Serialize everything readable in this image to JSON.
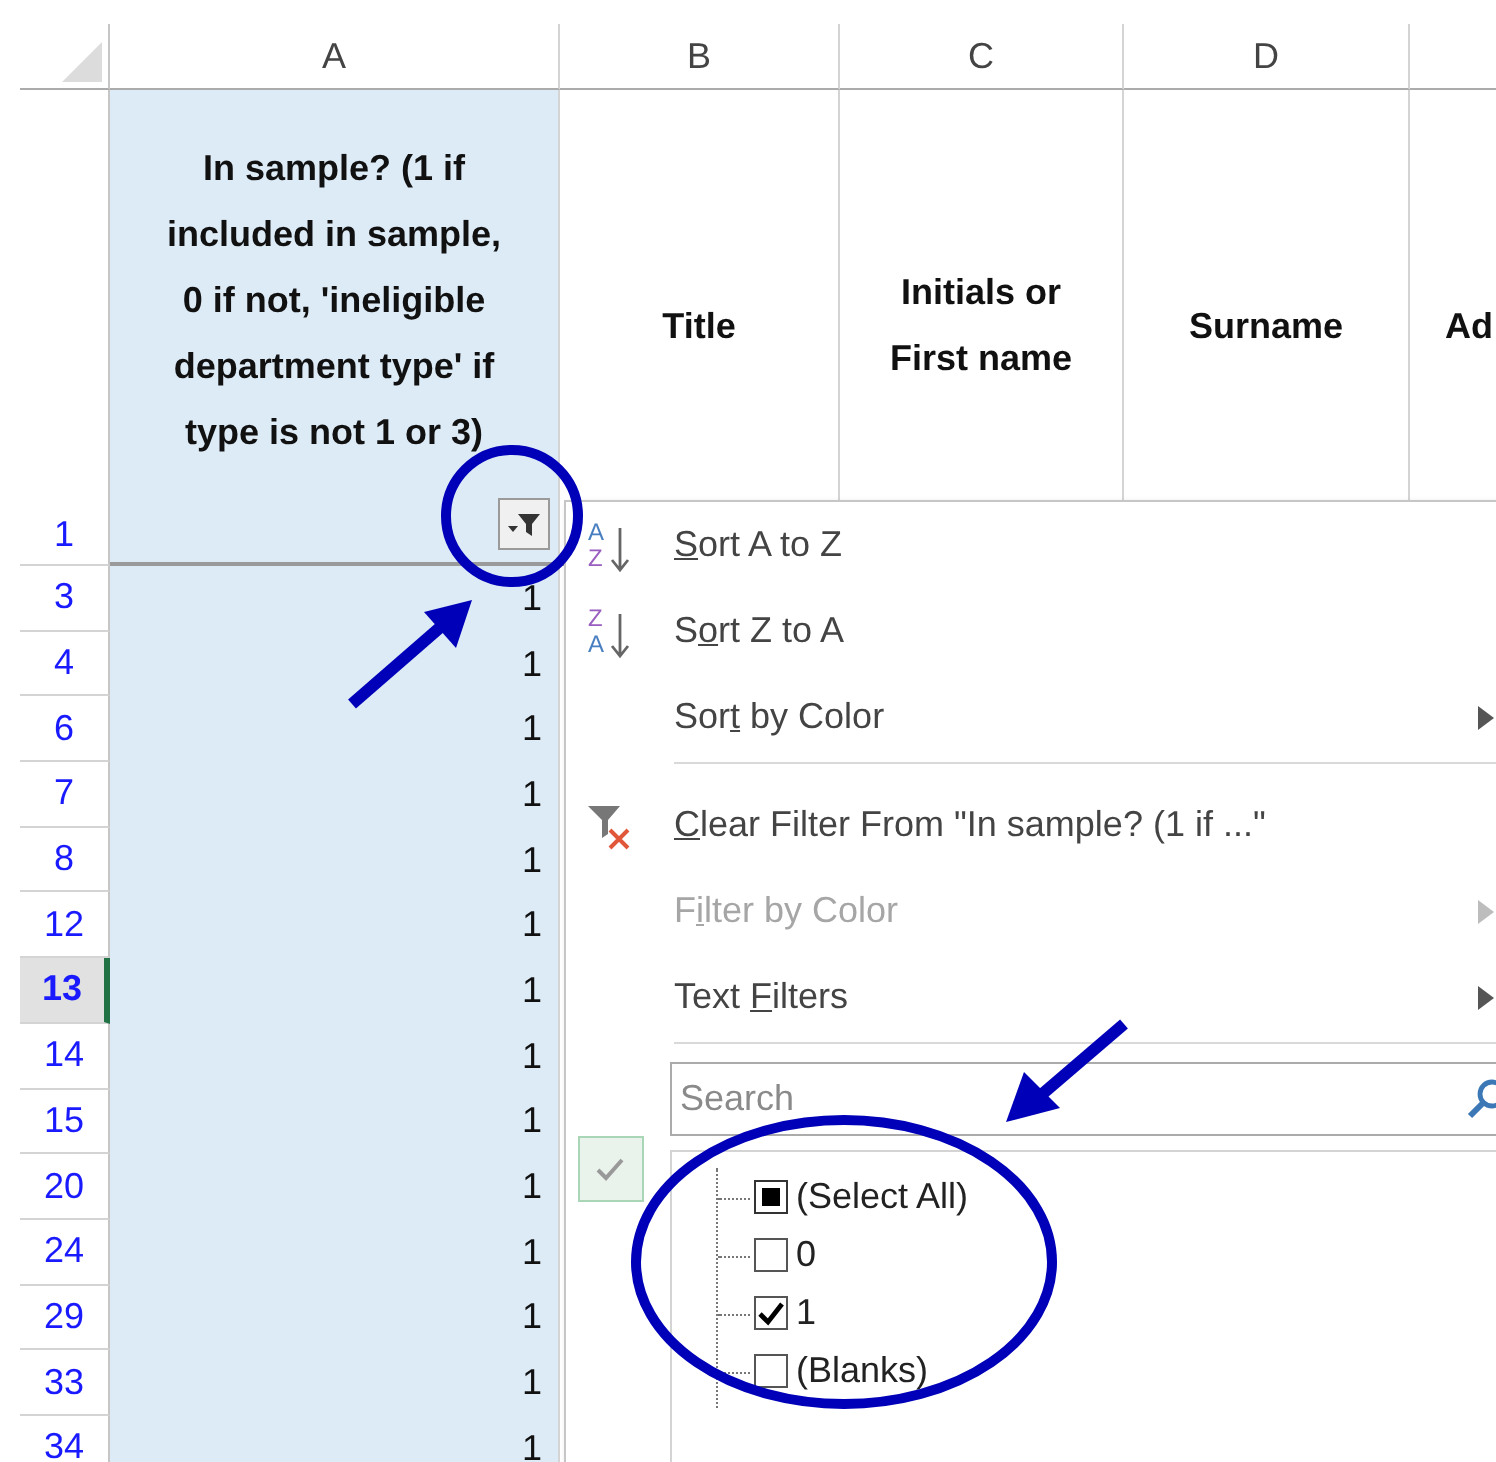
{
  "sheet": {
    "header_row": {
      "number": "1"
    },
    "columns": [
      {
        "letter": "A",
        "heading": "In sample? (1 if included in sample, 0 if not, 'ineligible department type' if type is not 1 or 3)",
        "shaded": true,
        "filter": true
      },
      {
        "letter": "B",
        "heading": "Title",
        "shaded": false,
        "filter": false
      },
      {
        "letter": "C",
        "heading": "Initials or First name",
        "shaded": false,
        "filter": false
      },
      {
        "letter": "D",
        "heading": "Surname",
        "shaded": false,
        "filter": false
      },
      {
        "heading": "Ad",
        "shaded": false,
        "filter": false
      }
    ],
    "rows": [
      {
        "number": "3",
        "value": "1",
        "selected": false
      },
      {
        "number": "4",
        "value": "1",
        "selected": false
      },
      {
        "number": "6",
        "value": "1",
        "selected": false
      },
      {
        "number": "7",
        "value": "1",
        "selected": false
      },
      {
        "number": "8",
        "value": "1",
        "selected": false
      },
      {
        "number": "12",
        "value": "1",
        "selected": false
      },
      {
        "number": "13",
        "value": "1",
        "selected": true
      },
      {
        "number": "14",
        "value": "1",
        "selected": false
      },
      {
        "number": "15",
        "value": "1",
        "selected": false
      },
      {
        "number": "20",
        "value": "1",
        "selected": false
      },
      {
        "number": "24",
        "value": "1",
        "selected": false
      },
      {
        "number": "29",
        "value": "1",
        "selected": false
      },
      {
        "number": "33",
        "value": "1",
        "selected": false
      },
      {
        "number": "34",
        "value": "1",
        "selected": false
      }
    ]
  },
  "filter_menu": {
    "items": [
      {
        "kind": "sort_ascending",
        "icon_letters": [
          "A",
          "Z"
        ],
        "access_key": "S",
        "label_end": "ort A to Z",
        "disabled": false
      },
      {
        "kind": "sort_descending",
        "icon_letters": [
          "Z",
          "A"
        ],
        "label_start": "S",
        "access_key": "o",
        "label_end": "rt Z to A",
        "disabled": false
      },
      {
        "kind": "submenu",
        "label_start": "Sor",
        "access_key": "t",
        "label_end": " by Color",
        "disabled": false
      },
      {
        "kind": "separator"
      },
      {
        "kind": "clear_filter",
        "access_key": "C",
        "label_end": "lear Filter From \"In sample? (1 if ...\"",
        "disabled": false
      },
      {
        "kind": "submenu",
        "label_start": "F",
        "access_key": "i",
        "label_end": "lter by Color",
        "disabled": true
      },
      {
        "kind": "submenu",
        "label_start": "Text ",
        "access_key": "F",
        "label_end": "ilters",
        "disabled": false
      },
      {
        "kind": "separator"
      }
    ],
    "search": {
      "placeholder": "Search"
    },
    "values": [
      {
        "label": "(Select All)",
        "checked": false,
        "indeterminate": true
      },
      {
        "label": "0",
        "checked": false,
        "indeterminate": false
      },
      {
        "label": "1",
        "checked": true,
        "indeterminate": false
      },
      {
        "label": "(Blanks)",
        "checked": false,
        "indeterminate": false
      }
    ]
  }
}
